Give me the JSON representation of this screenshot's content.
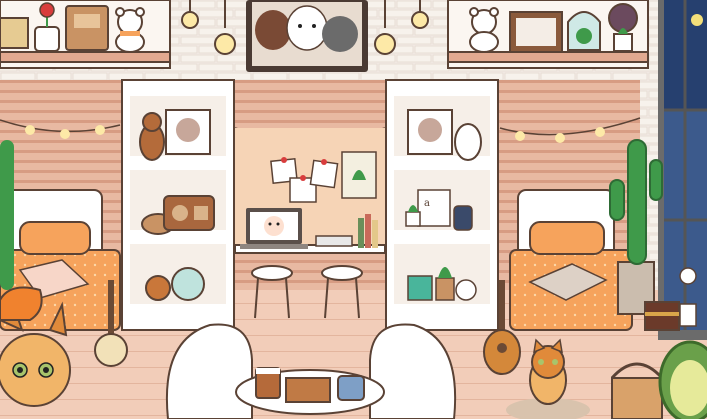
{
  "scene": {
    "type": "cozy-bedroom",
    "colors": {
      "wall": "#f3ece6",
      "wood_panel": "#e8b9a2",
      "wood_stripe": "#d89f86",
      "floor": "#f0cbb8",
      "shelf_white": "#ffffff",
      "outline": "#5a4235",
      "bed_orange": "#f6a35c",
      "rug": "#d9c3ad",
      "plant_green": "#3f9a4a",
      "night_window": "#3c5a8c"
    }
  },
  "tv": {
    "screen_subject": "three-bears-cartoon"
  },
  "laptop": {
    "screen_subject": "smiling-character-face"
  },
  "note_text": "a",
  "icons": [
    "rose-vase-icon",
    "box-icon",
    "teddy-bear-icon",
    "picture-frame-icon",
    "terrarium-icon",
    "plant-icon",
    "cat-icon",
    "guitar-icon",
    "banjo-icon",
    "avocado-icon",
    "treasure-chest-icon",
    "radio-icon",
    "lamp-bulb-icon",
    "cactus-icon",
    "basket-icon",
    "coffee-cup-icon"
  ]
}
